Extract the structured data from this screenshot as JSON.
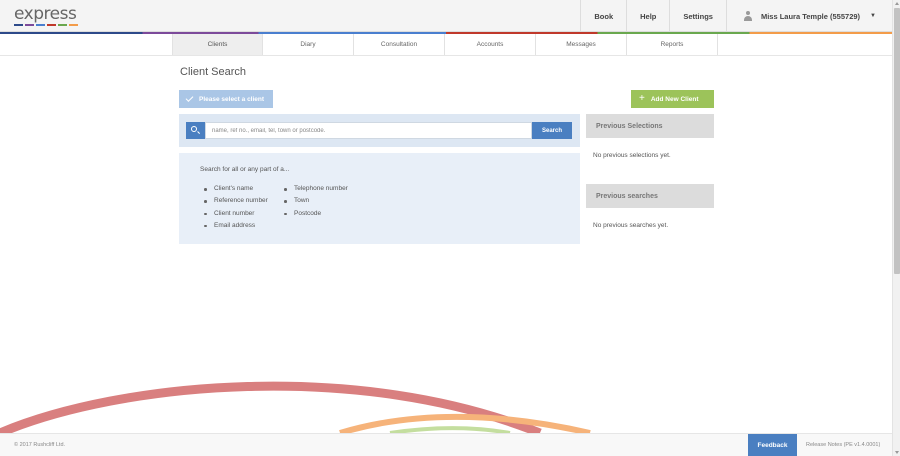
{
  "brand": {
    "logo_text": "express",
    "dot_colors": [
      "#2d4a8a",
      "#7c4a9a",
      "#4a7fcf",
      "#c0392b",
      "#6aa84f",
      "#f39c4a"
    ]
  },
  "topnav": {
    "book": "Book",
    "help": "Help",
    "settings": "Settings",
    "user": "Miss Laura Temple (555729)"
  },
  "tabs": [
    "Clients",
    "Diary",
    "Consultation",
    "Accounts",
    "Messages",
    "Reports"
  ],
  "active_tab": "Clients",
  "page": {
    "title": "Client Search",
    "select_button": "Please select a client",
    "add_button": "Add New Client"
  },
  "search": {
    "placeholder": "name, ref no., email, tel, town or postcode.",
    "button": "Search"
  },
  "help": {
    "intro": "Search for all or any part of a...",
    "col1": [
      "Client's name",
      "Reference number",
      "Client number",
      "Email address"
    ],
    "col2": [
      "Telephone number",
      "Town",
      "Postcode"
    ]
  },
  "sidebar": {
    "previous_selections_title": "Previous Selections",
    "previous_selections_empty": "No previous selections yet.",
    "previous_searches_title": "Previous searches",
    "previous_searches_empty": "No previous searches yet."
  },
  "footer": {
    "copyright": "© 2017 Rushcliff Ltd.",
    "feedback": "Feedback",
    "release": "Release Notes (PE v1.4.0001)"
  },
  "colors": {
    "primary_blue": "#4a7fc1",
    "green": "#9cc35a",
    "arc_red": "#d97f7f",
    "arc_orange": "#f6b37a",
    "arc_green": "#c4de9f"
  }
}
